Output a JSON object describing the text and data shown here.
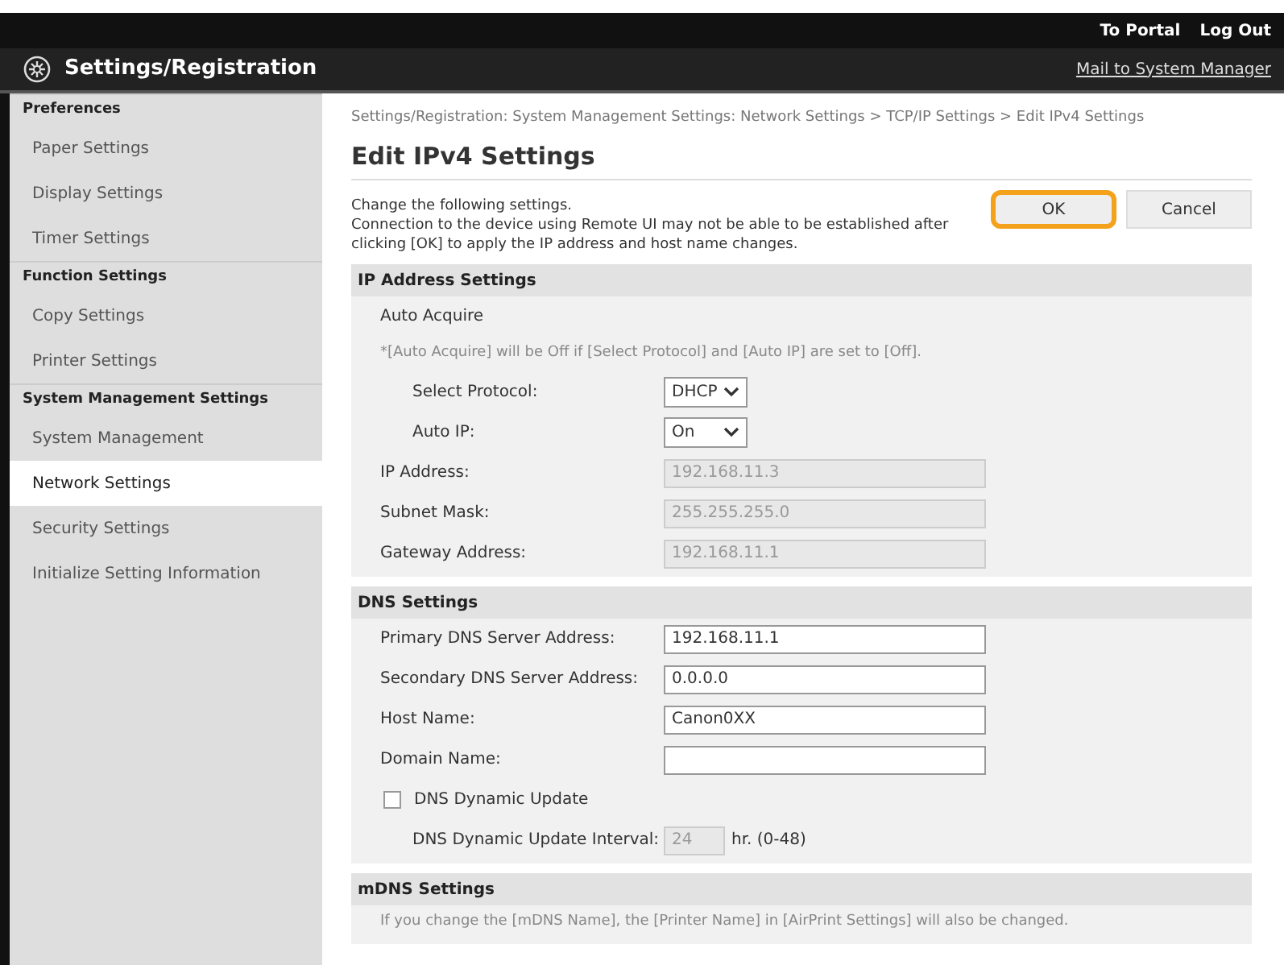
{
  "top_links": [
    "To Portal",
    "Log Out"
  ],
  "header": {
    "title": "Settings/Registration",
    "link": "Mail to System Manager"
  },
  "sidebar": [
    {
      "heading": "Preferences",
      "items": [
        {
          "label": "Paper Settings",
          "selected": false
        },
        {
          "label": "Display Settings",
          "selected": false
        },
        {
          "label": "Timer Settings",
          "selected": false
        }
      ]
    },
    {
      "heading": "Function Settings",
      "items": [
        {
          "label": "Copy Settings",
          "selected": false
        },
        {
          "label": "Printer Settings",
          "selected": false
        }
      ]
    },
    {
      "heading": "System Management Settings",
      "items": [
        {
          "label": "System Management",
          "selected": false
        },
        {
          "label": "Network Settings",
          "selected": true
        },
        {
          "label": "Security Settings",
          "selected": false
        },
        {
          "label": "Initialize Setting Information",
          "selected": false
        }
      ]
    }
  ],
  "breadcrumb": "Settings/Registration: System Management Settings: Network Settings > TCP/IP Settings > Edit IPv4 Settings",
  "title": "Edit IPv4 Settings",
  "intro": [
    "Change the following settings.",
    "Connection to the device using Remote UI may not be able to be established after clicking [OK] to apply the IP address and host name changes."
  ],
  "buttons": [
    {
      "label": "OK",
      "highlighted": true
    },
    {
      "label": "Cancel",
      "highlighted": false
    }
  ],
  "sections": [
    {
      "title": "IP Address Settings",
      "rows": [
        {
          "kind": "label",
          "label": "Auto Acquire"
        },
        {
          "kind": "note",
          "label": "*[Auto Acquire] will be Off if [Select Protocol] and [Auto IP] are set to [Off]."
        },
        {
          "kind": "select",
          "label": "Select Protocol:",
          "value": "DHCP",
          "indent": true
        },
        {
          "kind": "select",
          "label": "Auto IP:",
          "value": "On",
          "indent": true
        },
        {
          "kind": "readonly",
          "label": "IP Address:",
          "value": "192.168.11.3"
        },
        {
          "kind": "readonly",
          "label": "Subnet Mask:",
          "value": "255.255.255.0"
        },
        {
          "kind": "readonly",
          "label": "Gateway Address:",
          "value": "192.168.11.1"
        }
      ]
    },
    {
      "title": "DNS Settings",
      "rows": [
        {
          "kind": "input",
          "label": "Primary DNS Server Address:",
          "value": "192.168.11.1"
        },
        {
          "kind": "input",
          "label": "Secondary DNS Server Address:",
          "value": "0.0.0.0"
        },
        {
          "kind": "input",
          "label": "Host Name:",
          "value": "Canon0XX"
        },
        {
          "kind": "input",
          "label": "Domain Name:"
        },
        {
          "kind": "checkbox",
          "label": "DNS Dynamic Update",
          "checked": false
        },
        {
          "kind": "interval",
          "label": "DNS Dynamic Update Interval:",
          "value": "24",
          "unit": "hr. (0-48)",
          "indent": true
        }
      ]
    },
    {
      "title": "mDNS Settings",
      "rows": [
        {
          "kind": "note",
          "label": "If you change the [mDNS Name], the [Printer Name] in [AirPrint Settings] will also be changed."
        }
      ]
    }
  ]
}
